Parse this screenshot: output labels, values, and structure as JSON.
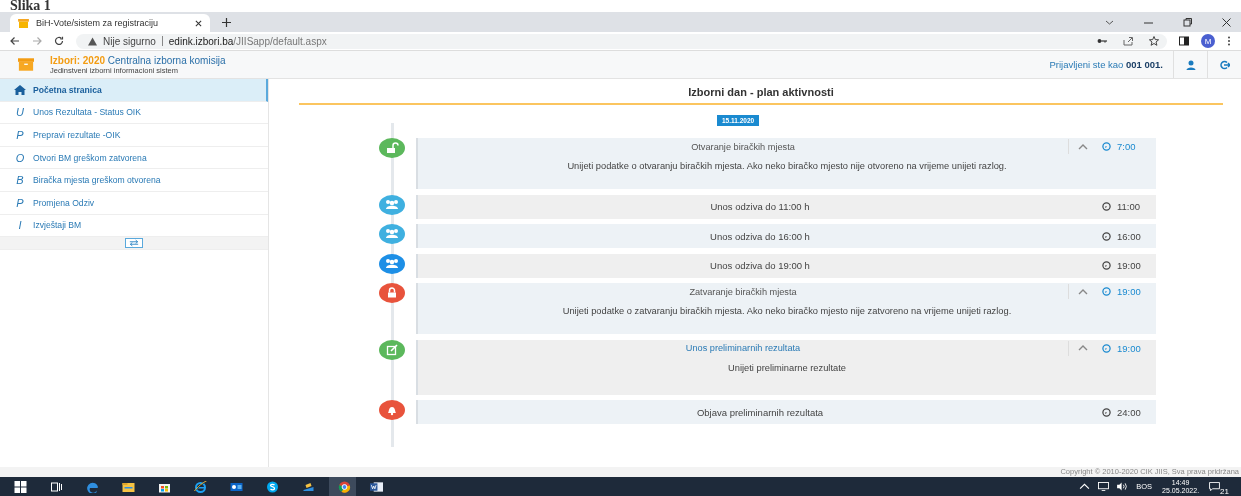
{
  "caption": "Slika 1",
  "browser": {
    "tab_title": "BiH-Vote/sistem za registraciju",
    "security": "Nije sigurno",
    "url_host": "edink.izbori.ba",
    "url_path": "/JIISapp/default.aspx",
    "profile": "M"
  },
  "header": {
    "brand": "Izbori: 2020",
    "org": "Centralna izborna komisija",
    "subtitle": "Jedinstveni izborni informacioni sistem",
    "login": "Prijavljeni ste kao **001 001.**"
  },
  "sidebar": {
    "items": [
      {
        "kind": "home",
        "label": "Početna stranica",
        "selected": true
      },
      {
        "kind": "letter",
        "letter": "U",
        "label": "Unos Rezultata - Status OIK",
        "selected": false
      },
      {
        "kind": "letter",
        "letter": "P",
        "label": "Prepravi rezultate -OIK",
        "selected": false
      },
      {
        "kind": "letter",
        "letter": "O",
        "label": "Otvori BM greškom zatvorena",
        "selected": false
      },
      {
        "kind": "letter",
        "letter": "B",
        "label": "Biračka mjesta greškom otvorena",
        "selected": false
      },
      {
        "kind": "letter",
        "letter": "P",
        "label": "Promjena Odziv",
        "selected": false
      },
      {
        "kind": "letter",
        "letter": "I",
        "label": "Izvještaji BM",
        "selected": false
      }
    ]
  },
  "main": {
    "title": "Izborni dan - plan aktivnosti",
    "date": "15.11.2020",
    "activities": [
      {
        "kind": "opening",
        "color": "#5cb85c",
        "title": "Otvaranje biračkih mjesta",
        "link": false,
        "description": "Unijeti podatke o otvaranju biračkih mjesta. Ako neko biračko mjesto nije otvoreno na vrijeme unijeti razlog.",
        "time": "7:00"
      },
      {
        "kind": "turnout",
        "color": "#3fb0e0",
        "title": "Unos odziva do 11:00 h",
        "time": "11:00"
      },
      {
        "kind": "turnout",
        "color": "#3fb0e0",
        "title": "Unos odziva do 16:00 h",
        "time": "16:00"
      },
      {
        "kind": "turnout",
        "color": "#1d8fe6",
        "title": "Unos odziva do 19:00 h",
        "time": "19:00"
      },
      {
        "kind": "closing",
        "color": "#e8533c",
        "title": "Zatvaranje biračkih mjesta",
        "link": false,
        "description": "Unijeti podatke o zatvaranju biračkih mjesta. Ako neko biračko mjesto nije zatvoreno na vrijeme unijeti razlog.",
        "time": "19:00"
      },
      {
        "kind": "results",
        "color": "#5cb85c",
        "title": "Unos preliminarnih rezultata",
        "link": true,
        "description": "Unijeti preliminarne rezultate",
        "time": "19:00"
      },
      {
        "kind": "publish",
        "color": "#e8533c",
        "title": "Objava preliminarnih rezultata",
        "time": "24:00"
      }
    ]
  },
  "footer": {
    "copyright": "Copyright © 2010-2020 CIK JIIS, Sva prava pridržana"
  },
  "taskbar": {
    "language": "BOS",
    "time": "14:49",
    "date": "25.05.2022.",
    "notifications": "21"
  }
}
